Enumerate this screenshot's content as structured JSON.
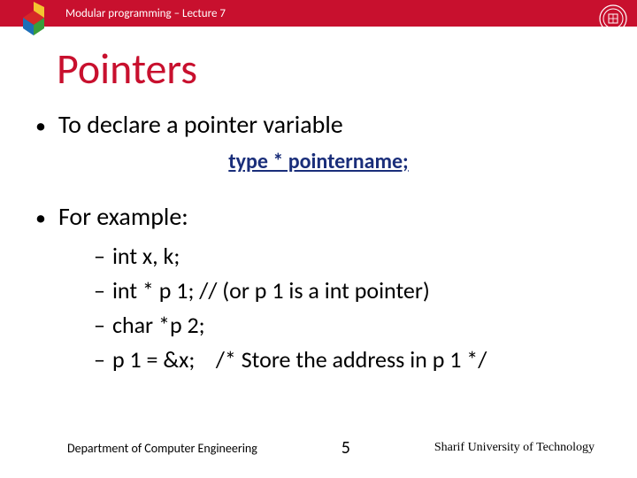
{
  "header": {
    "breadcrumb": "Modular programming – Lecture 7"
  },
  "title": "Pointers",
  "bullets": {
    "b1": "To declare a pointer variable",
    "syntax": "type * pointername;",
    "b2": "For example:",
    "sub": [
      "int x, k;",
      "int * p 1; // (or p 1 is a int pointer)",
      "char *p 2;",
      "p 1 = &x;    /* Store the address in p 1 */"
    ]
  },
  "footer": {
    "left": "Department of Computer Engineering",
    "page": "5",
    "right": "Sharif University of Technology"
  }
}
